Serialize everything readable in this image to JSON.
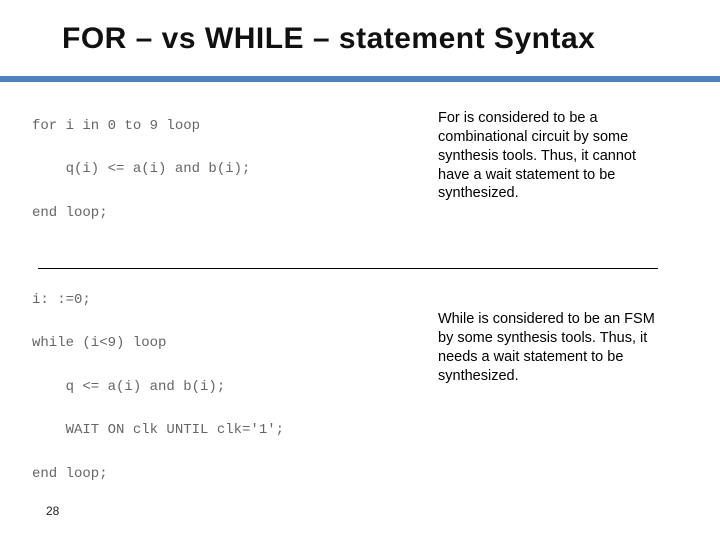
{
  "slide": {
    "title": "FOR – vs WHILE – statement Syntax",
    "page_number": "28"
  },
  "upper": {
    "code": "for i in 0 to 9 loop\n\n    q(i) <= a(i) and b(i);\n\nend loop;",
    "description": "For is considered to be a combinational circuit by some synthesis tools. Thus, it cannot have a wait statement to be synthesized."
  },
  "lower": {
    "code": "i: :=0;\n\nwhile (i<9) loop\n\n    q <= a(i) and b(i);\n\n    WAIT ON clk UNTIL clk='1';\n\nend loop;",
    "description": "While is considered to be an FSM by some synthesis tools. Thus, it needs a wait statement to be synthesized."
  }
}
